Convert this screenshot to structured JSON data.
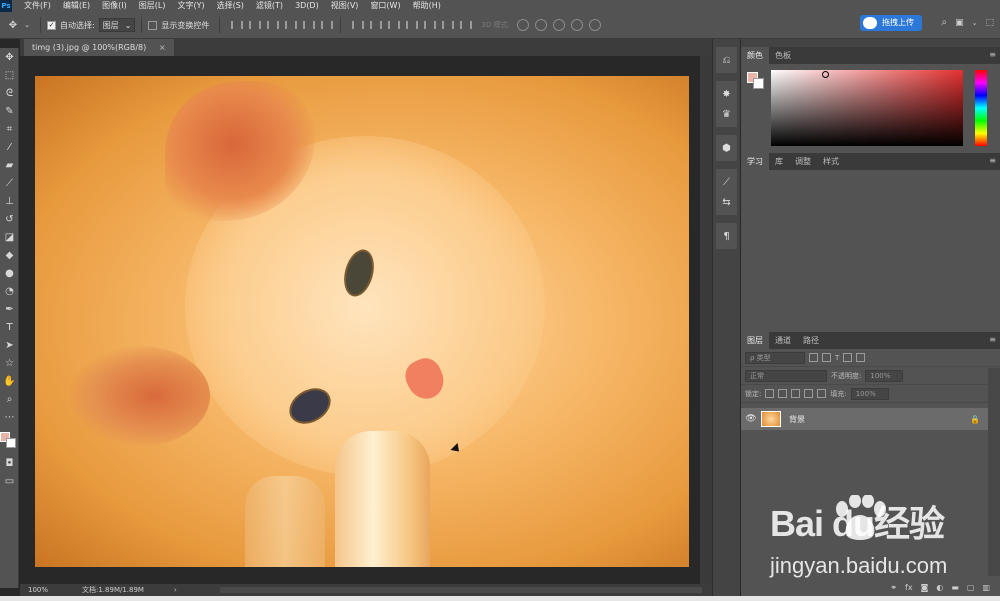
{
  "app": {
    "logo_text": "Ps"
  },
  "menu": [
    "文件(F)",
    "编辑(E)",
    "图像(I)",
    "图层(L)",
    "文字(Y)",
    "选择(S)",
    "滤镜(T)",
    "3D(D)",
    "视图(V)",
    "窗口(W)",
    "帮助(H)"
  ],
  "options": {
    "auto_select_label": "自动选择:",
    "auto_select_value": "图层",
    "show_transform_label": "显示变换控件",
    "mode3d_label": "3D 模式:",
    "upload_label": "拖拽上传"
  },
  "document": {
    "tab_title": "timg (3).jpg @ 100%(RGB/8)",
    "tab_close": "×",
    "zoom": "100%",
    "doc_size": "文档:1.89M/1.89M",
    "status_arrow": "›"
  },
  "panels": {
    "color_tabs": [
      "颜色",
      "色板"
    ],
    "learn_tabs": [
      "学习",
      "库",
      "调整",
      "样式"
    ],
    "layers_tabs": [
      "图层",
      "通道",
      "路径"
    ],
    "menu_glyph": "≡"
  },
  "layers": {
    "kind_filter": "ρ 类型",
    "blend_mode": "正常",
    "opacity_label": "不透明度:",
    "opacity_value": "100%",
    "lock_label": "锁定:",
    "fill_label": "填充:",
    "fill_value": "100%",
    "layer_name": "背景",
    "eye_glyph": "👁",
    "lock_glyph": "🔒"
  },
  "watermark": {
    "logo": "Bai  du经验",
    "url": "jingyan.baidu.com"
  },
  "colors": {
    "foreground": "#e6b3a6",
    "background": "#ffffff",
    "accent": "#2b78d8"
  }
}
